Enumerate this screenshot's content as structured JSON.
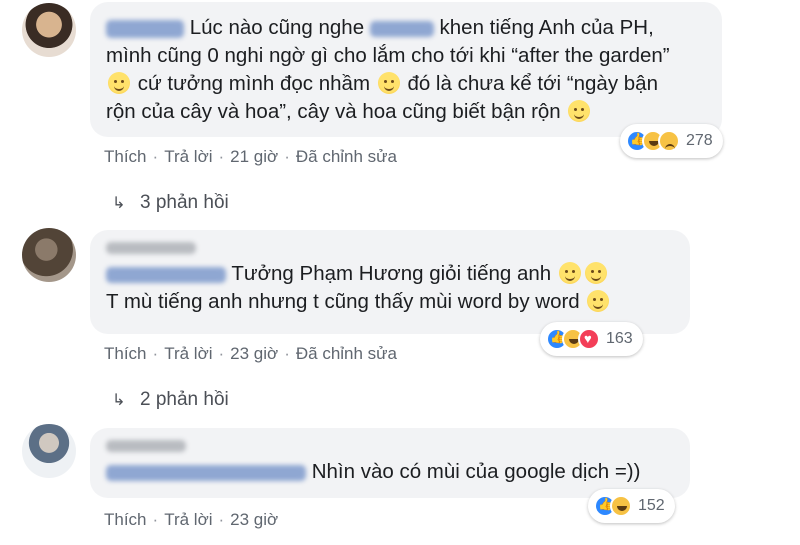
{
  "comments": [
    {
      "line1": "Lúc nào cũng nghe",
      "line1b": "khen tiếng Anh của PH,",
      "line2": "mình cũng 0 nghi ngờ gì cho lắm cho tới khi “after the garden”",
      "line3a": "cứ tưởng mình đọc nhầm",
      "line3b": "đó là chưa kể tới “ngày bận",
      "line4": "rộn của cây và hoa”, cây và hoa cũng biết bận rộn",
      "actions": {
        "like": "Thích",
        "reply": "Trả lời",
        "time": "21 giờ",
        "edited": "Đã chỉnh sửa"
      },
      "reaction_count": "278",
      "reactions": [
        "like-icon",
        "haha-icon",
        "sad-icon"
      ],
      "replies_label": "3 phản hồi"
    },
    {
      "line1": "Tưởng Phạm Hương giỏi tiếng anh",
      "line2": "T mù tiếng anh nhưng t cũng thấy mùi word by word",
      "actions": {
        "like": "Thích",
        "reply": "Trả lời",
        "time": "23 giờ",
        "edited": "Đã chỉnh sửa"
      },
      "reaction_count": "163",
      "reactions": [
        "like-icon",
        "haha-icon",
        "love-icon"
      ],
      "replies_label": "2 phản hồi"
    },
    {
      "line1": "Nhìn vào có mùi của google dịch =))",
      "actions": {
        "like": "Thích",
        "reply": "Trả lời",
        "time": "23 giờ"
      },
      "reaction_count": "152",
      "reactions": [
        "like-icon",
        "haha-icon"
      ]
    }
  ],
  "dot": "·"
}
